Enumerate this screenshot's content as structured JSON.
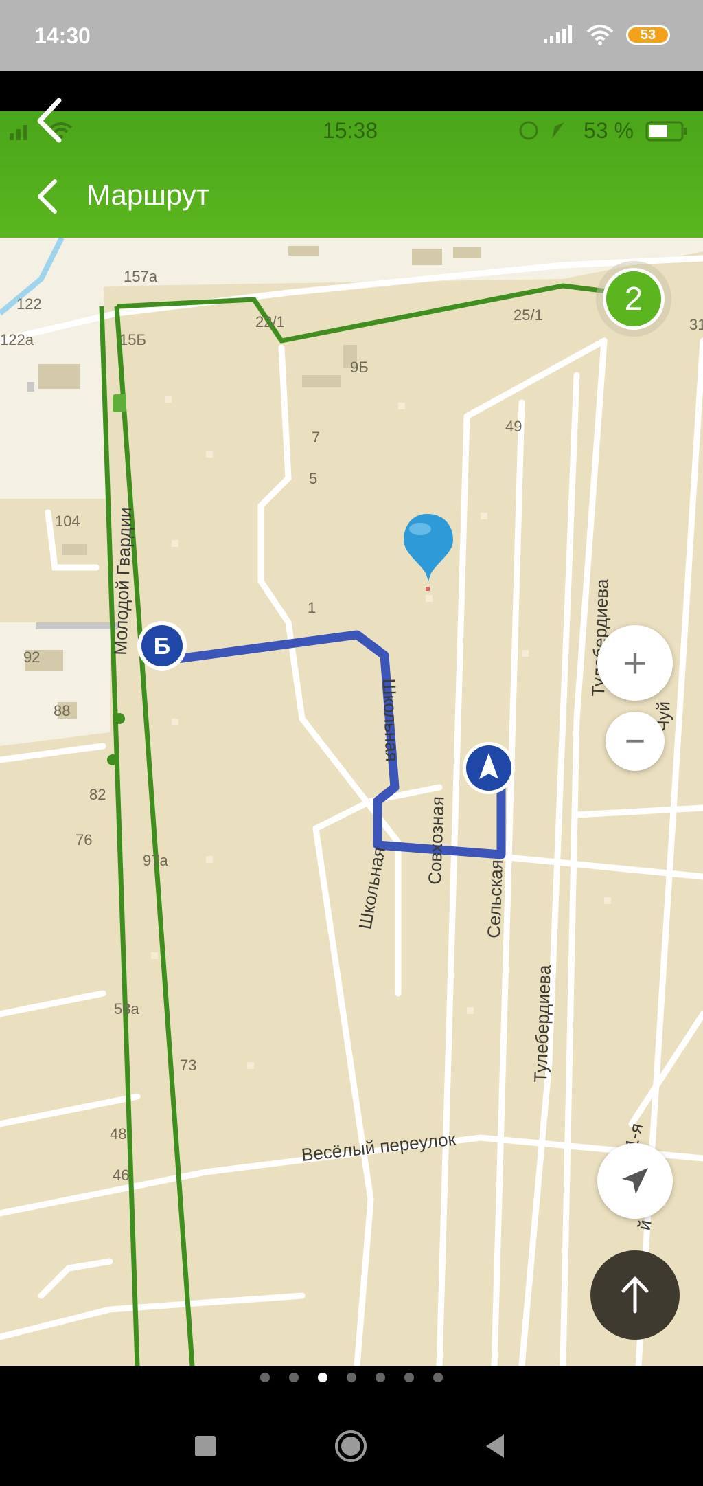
{
  "outer_status": {
    "time": "14:30",
    "battery": "53"
  },
  "inner_status": {
    "time": "15:38",
    "battery": "53 %"
  },
  "header": {
    "title": "Маршрут"
  },
  "map": {
    "addresses": [
      "157а",
      "122",
      "122а",
      "15Б",
      "22/1",
      "25/1",
      "9Б",
      "7",
      "5",
      "49",
      "104",
      "1",
      "92",
      "88",
      "82",
      "76",
      "97а",
      "58а",
      "73",
      "48",
      "46",
      "31"
    ],
    "streets": {
      "molodoy_gvardii": "Молодой Гвардии",
      "shkolnaya_1": "Школьная",
      "shkolnaya_2": "Школьная",
      "sovkhoznaya": "Совхозная",
      "selskaya": "Сельская",
      "tuleberdieva_1": "Тулебердиева",
      "tuleberdieva_2": "Тулебердиева",
      "veselyy": "Весёлый переулок",
      "chuy": "Чуй",
      "k41": "4-1-я",
      "k45": "й 45-я"
    },
    "cluster_count": "2",
    "marker_end": "Б",
    "colors": {
      "route": "#3c55b8",
      "green_route": "#3f8f1f",
      "header": "#52ae1c",
      "map_bg": "#eadfbf"
    }
  },
  "controls": {
    "zoom_in": "+",
    "zoom_out": "−",
    "locate_icon": "navigation-arrow-icon",
    "scroll_top_icon": "arrow-up-icon"
  },
  "pager": {
    "count": 7,
    "active": 3
  },
  "nav": {
    "icons": [
      "recent-apps-icon",
      "home-icon",
      "back-icon"
    ]
  }
}
